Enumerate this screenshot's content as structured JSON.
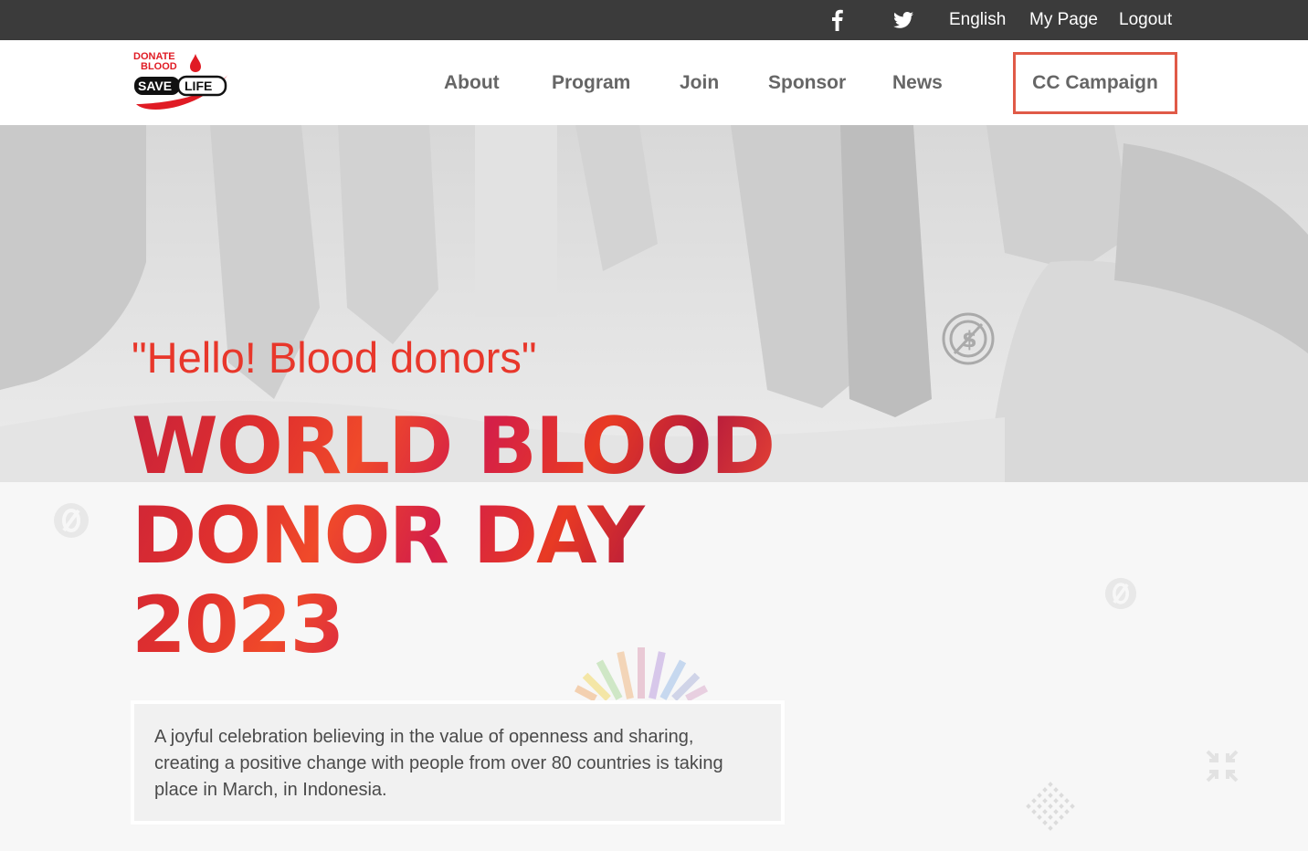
{
  "topbar": {
    "facebook_icon": "facebook-icon",
    "twitter_icon": "twitter-icon",
    "language": "English",
    "my_page": "My Page",
    "logout": "Logout"
  },
  "logo": {
    "line1": "DONATE",
    "line2": "BLOOD",
    "save": "SAVE",
    "life": "LIFE"
  },
  "nav": {
    "items": [
      "About",
      "Program",
      "Join",
      "Sponsor",
      "News"
    ],
    "cc_campaign": "CC Campaign"
  },
  "hero": {
    "greeting": "\"Hello! Blood donors\"",
    "title_line1": "WORLD BLOOD",
    "title_line2": "DONOR DAY",
    "title_line3": "2023",
    "description": "A joyful celebration believing in the value of openness and sharing, creating a positive change with people from over 80 countries is taking place in March, in Indonesia."
  },
  "colors": {
    "topbar_bg": "#3b3b3b",
    "accent_red": "#e8372b",
    "highlight_border": "#e05a47",
    "nav_text": "#666666"
  }
}
